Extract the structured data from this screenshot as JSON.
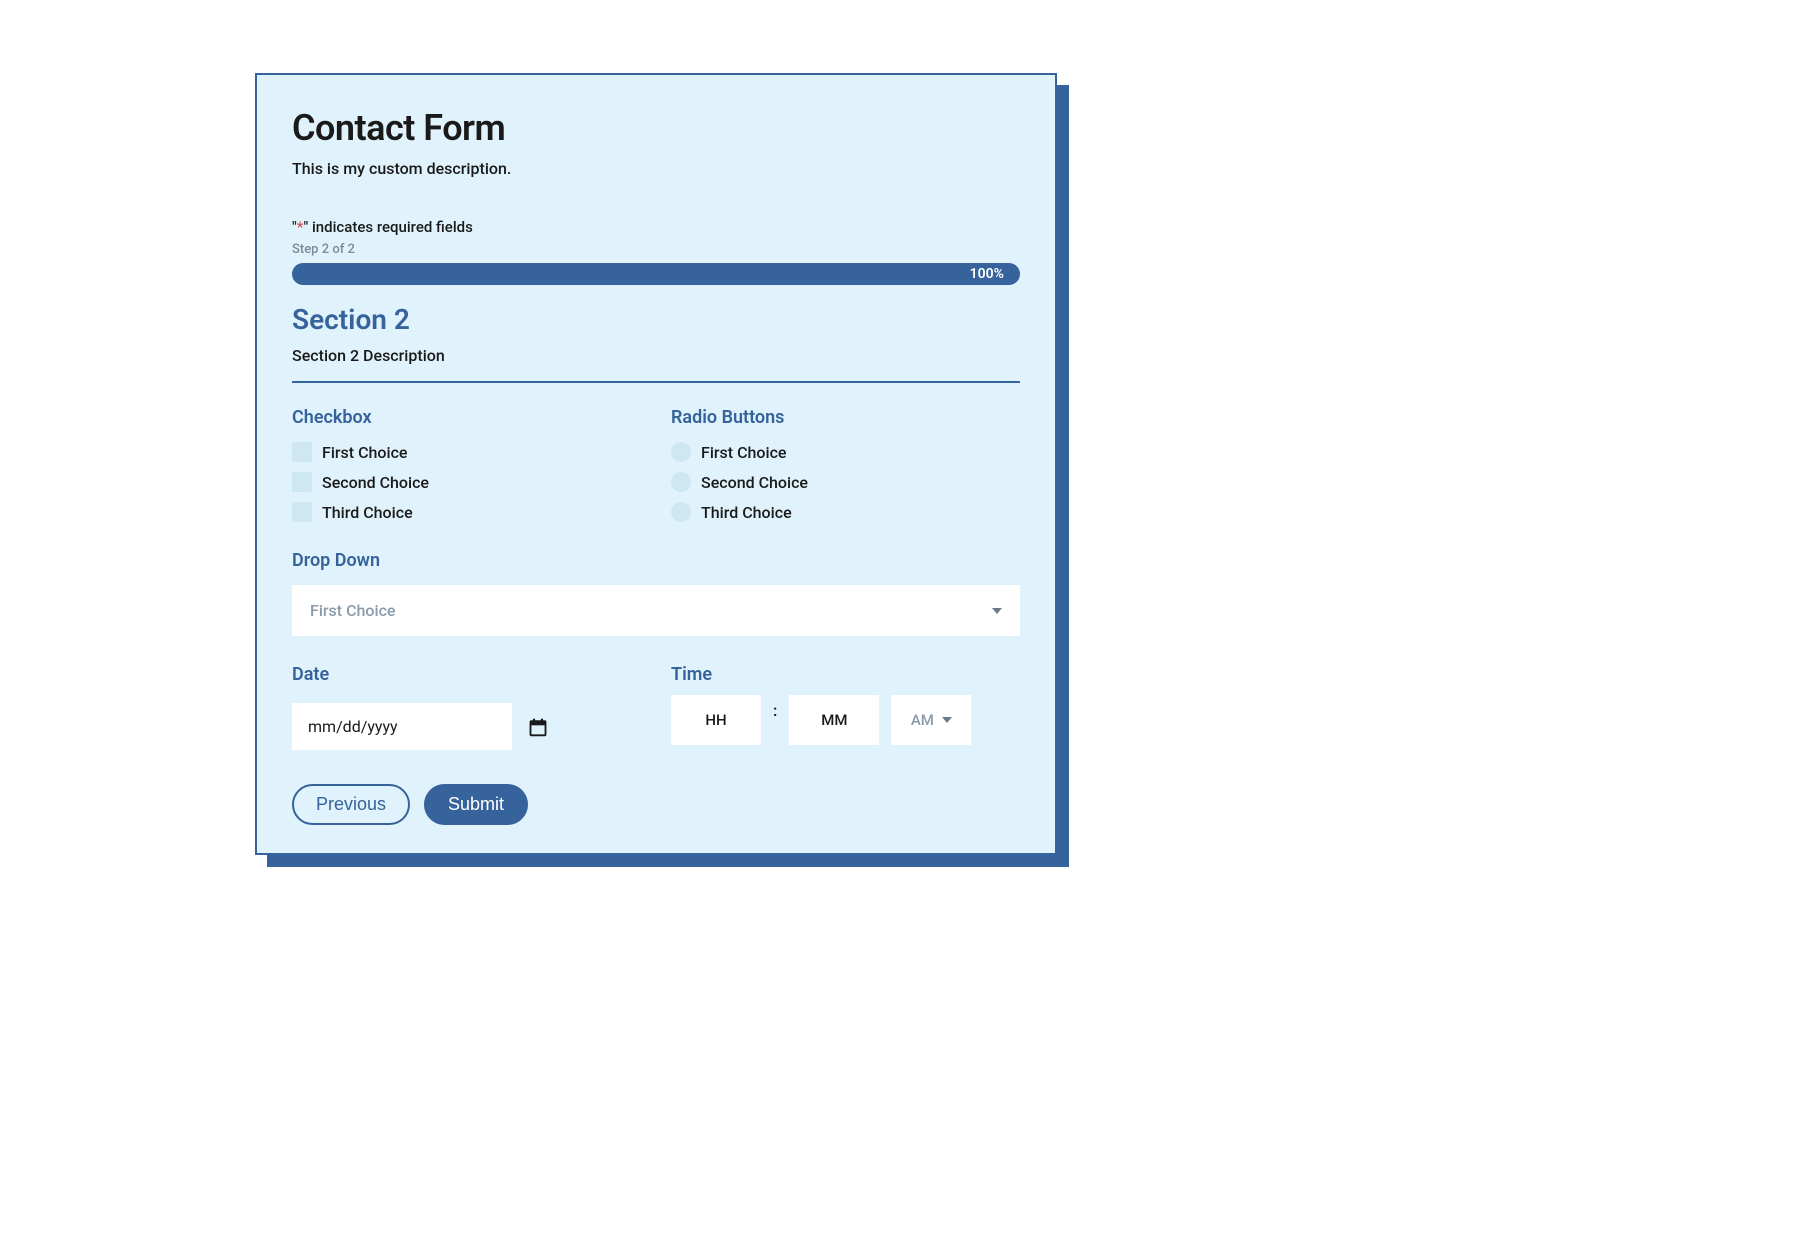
{
  "form": {
    "title": "Contact Form",
    "description": "This is my custom description.",
    "required_note_prefix": "\"",
    "required_note_star": "*",
    "required_note_suffix": "\" indicates required fields",
    "step_label": "Step 2 of 2",
    "progress_text": "100%"
  },
  "section": {
    "title": "Section 2",
    "description": "Section 2 Description"
  },
  "checkbox": {
    "label": "Checkbox",
    "options": [
      "First Choice",
      "Second Choice",
      "Third Choice"
    ]
  },
  "radio": {
    "label": "Radio Buttons",
    "options": [
      "First Choice",
      "Second Choice",
      "Third Choice"
    ]
  },
  "dropdown": {
    "label": "Drop Down",
    "selected": "First Choice"
  },
  "date": {
    "label": "Date",
    "placeholder": "mm/dd/yyyy"
  },
  "time": {
    "label": "Time",
    "hh": "HH",
    "mm": "MM",
    "ampm": "AM",
    "colon": ":"
  },
  "buttons": {
    "previous": "Previous",
    "submit": "Submit"
  }
}
